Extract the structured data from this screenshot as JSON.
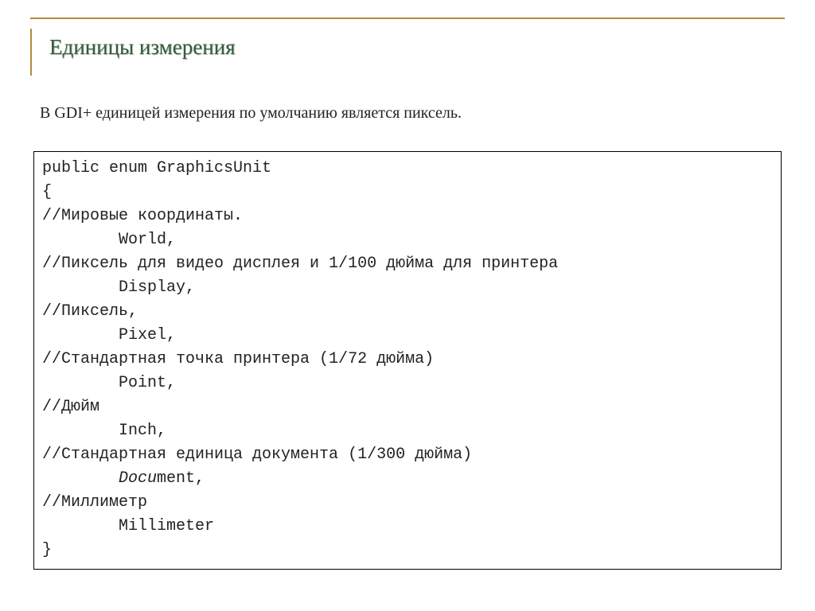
{
  "title": "Единицы измерения",
  "intro": "В GDI+ единицей измерения по умолчанию является пиксель.",
  "code": {
    "l1": "public enum GraphicsUnit",
    "l2": "{",
    "l3": "//Мировые координаты.",
    "l4": "        World,",
    "l5": "//Пиксель для видео дисплея и 1/100 дюйма для принтера",
    "l6": "        Display,",
    "l7": "//Пиксель,",
    "l8": "        Pixel,",
    "l9": "//Стандартная точка принтера (1/72 дюйма)",
    "l10": "        Point,",
    "l11": "//Дюйм",
    "l12": "        Inch,",
    "l13": "//Стандартная единица документа (1/300 дюйма)",
    "l14_pre": "        ",
    "l14_ital": "Docu",
    "l14_post": "ment,",
    "l15": "//Миллиметр",
    "l16": "        Millimeter",
    "l17": "}"
  }
}
